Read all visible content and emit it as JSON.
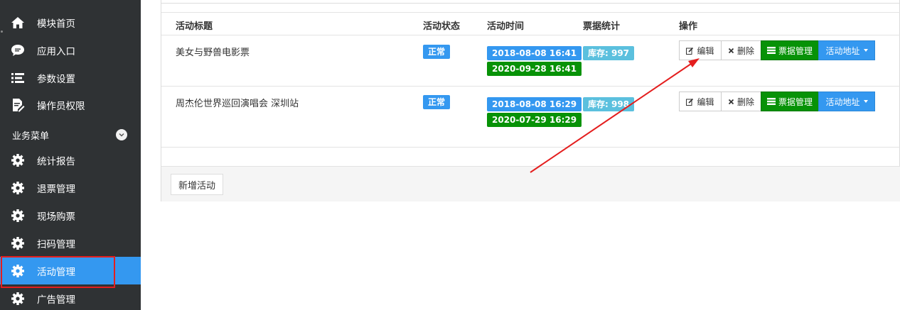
{
  "sidebar": {
    "items": [
      {
        "label": "模块首页",
        "icon": "home-icon"
      },
      {
        "label": "应用入口",
        "icon": "chat-icon"
      },
      {
        "label": "参数设置",
        "icon": "list-icon"
      },
      {
        "label": "操作员权限",
        "icon": "edit-doc-icon"
      }
    ],
    "section_label": "业务菜单",
    "business_items": [
      {
        "label": "统计报告",
        "icon": "gear-icon"
      },
      {
        "label": "退票管理",
        "icon": "gear-icon"
      },
      {
        "label": "现场购票",
        "icon": "gear-icon"
      },
      {
        "label": "扫码管理",
        "icon": "gear-icon"
      },
      {
        "label": "活动管理",
        "icon": "gear-icon",
        "active": true
      },
      {
        "label": "广告管理",
        "icon": "gear-icon"
      }
    ]
  },
  "table": {
    "headers": [
      "活动标题",
      "活动状态",
      "活动时间",
      "票据统计",
      "操作"
    ],
    "rows": [
      {
        "title": "美女与野兽电影票",
        "status": "正常",
        "start": "2018-08-08 16:41",
        "end": "2020-09-28 16:41",
        "stock": "库存: 997"
      },
      {
        "title": "周杰伦世界巡回演唱会 深圳站",
        "status": "正常",
        "start": "2018-08-08 16:29",
        "end": "2020-07-29 16:29",
        "stock": "库存: 998"
      }
    ],
    "actions": {
      "edit": "编辑",
      "delete": "删除",
      "ticket": "票据管理",
      "address": "活动地址"
    }
  },
  "footer": {
    "new_button": "新增活动"
  },
  "colors": {
    "sidebar_bg": "#2f3234",
    "active": "#3498f0",
    "green": "#079207",
    "teal": "#5bc0de",
    "highlight": "#e41e1e"
  }
}
